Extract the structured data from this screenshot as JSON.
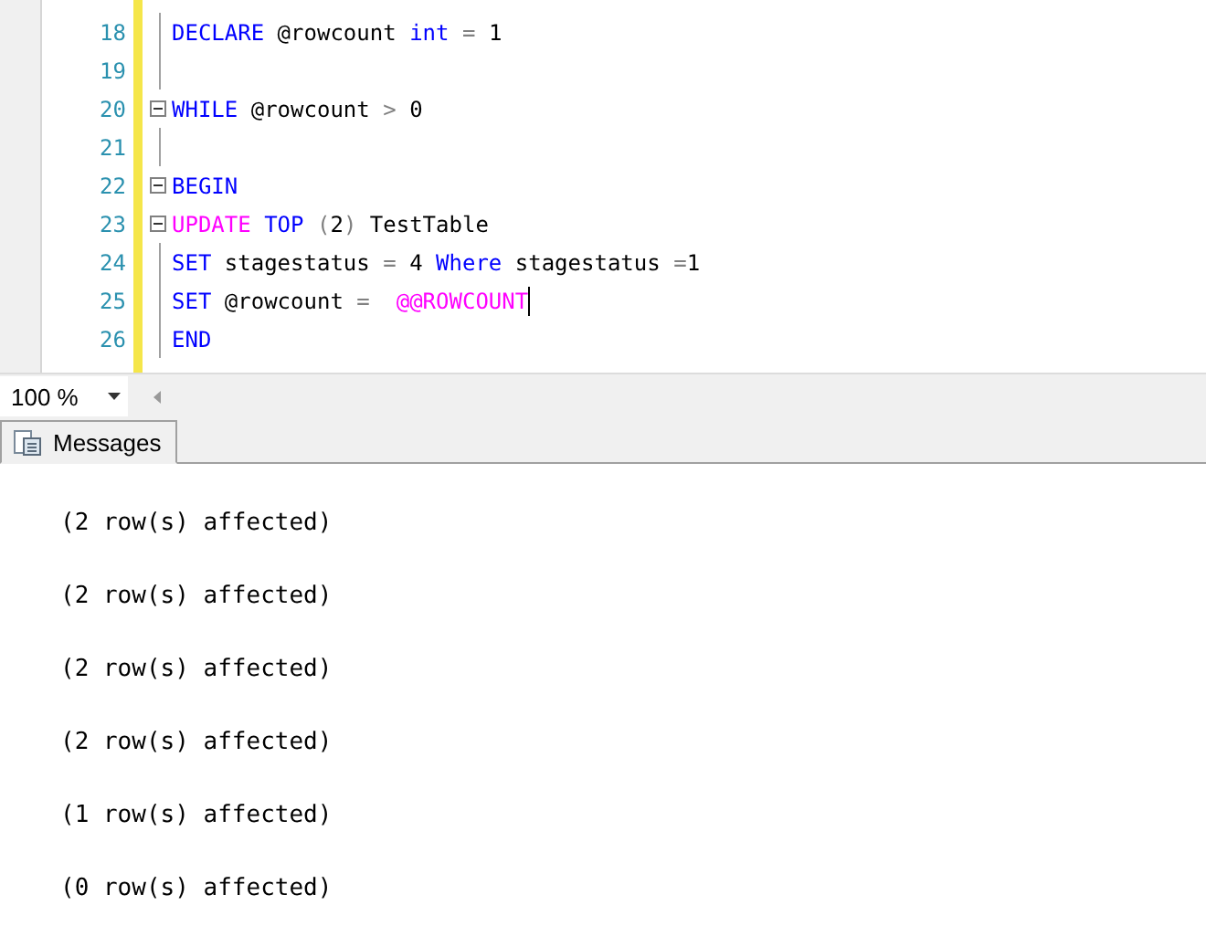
{
  "editor": {
    "lines": [
      {
        "number": "18",
        "fold": false,
        "caret": false,
        "tokens": [
          {
            "text": "DECLARE",
            "kind": "keyword"
          },
          {
            "text": " @rowcount ",
            "kind": "plain"
          },
          {
            "text": "int",
            "kind": "keyword"
          },
          {
            "text": " = ",
            "kind": "operator"
          },
          {
            "text": "1",
            "kind": "plain"
          }
        ]
      },
      {
        "number": "19",
        "fold": false,
        "caret": false
      },
      {
        "number": "20",
        "fold": true,
        "caret": false,
        "tokens": [
          {
            "text": "WHILE",
            "kind": "keyword"
          },
          {
            "text": " @rowcount ",
            "kind": "plain"
          },
          {
            "text": ">",
            "kind": "operator"
          },
          {
            "text": " 0",
            "kind": "plain"
          }
        ]
      },
      {
        "number": "21",
        "fold": false,
        "caret": false
      },
      {
        "number": "22",
        "fold": true,
        "caret": false,
        "tokens": [
          {
            "text": "BEGIN",
            "kind": "keyword"
          }
        ]
      },
      {
        "number": "23",
        "fold": true,
        "caret": false,
        "tokens": [
          {
            "text": "UPDATE",
            "kind": "function"
          },
          {
            "text": " TOP",
            "kind": "keyword"
          },
          {
            "text": " (",
            "kind": "operator"
          },
          {
            "text": "2",
            "kind": "plain"
          },
          {
            "text": ")",
            "kind": "operator"
          },
          {
            "text": " TestTable",
            "kind": "plain"
          }
        ]
      },
      {
        "number": "24",
        "fold": false,
        "caret": false,
        "tokens": [
          {
            "text": "SET",
            "kind": "keyword"
          },
          {
            "text": " stagestatus ",
            "kind": "plain"
          },
          {
            "text": "=",
            "kind": "operator"
          },
          {
            "text": " 4 ",
            "kind": "plain"
          },
          {
            "text": "Where",
            "kind": "keyword"
          },
          {
            "text": " stagestatus ",
            "kind": "plain"
          },
          {
            "text": "=",
            "kind": "operator"
          },
          {
            "text": "1",
            "kind": "plain"
          }
        ]
      },
      {
        "number": "25",
        "fold": false,
        "caret": true,
        "tokens": [
          {
            "text": "SET",
            "kind": "keyword"
          },
          {
            "text": " @rowcount ",
            "kind": "plain"
          },
          {
            "text": "=",
            "kind": "operator"
          },
          {
            "text": "  @@ROWCOUNT",
            "kind": "function"
          }
        ]
      },
      {
        "number": "26",
        "fold": false,
        "caret": false,
        "tokens": [
          {
            "text": "END",
            "kind": "keyword"
          }
        ]
      }
    ]
  },
  "zoom": {
    "value": "100 %"
  },
  "tabs": [
    {
      "label": "Messages",
      "selected": true
    }
  ],
  "messages": [
    "(2 row(s) affected)",
    "(2 row(s) affected)",
    "(2 row(s) affected)",
    "(2 row(s) affected)",
    "(1 row(s) affected)",
    "(0 row(s) affected)"
  ]
}
